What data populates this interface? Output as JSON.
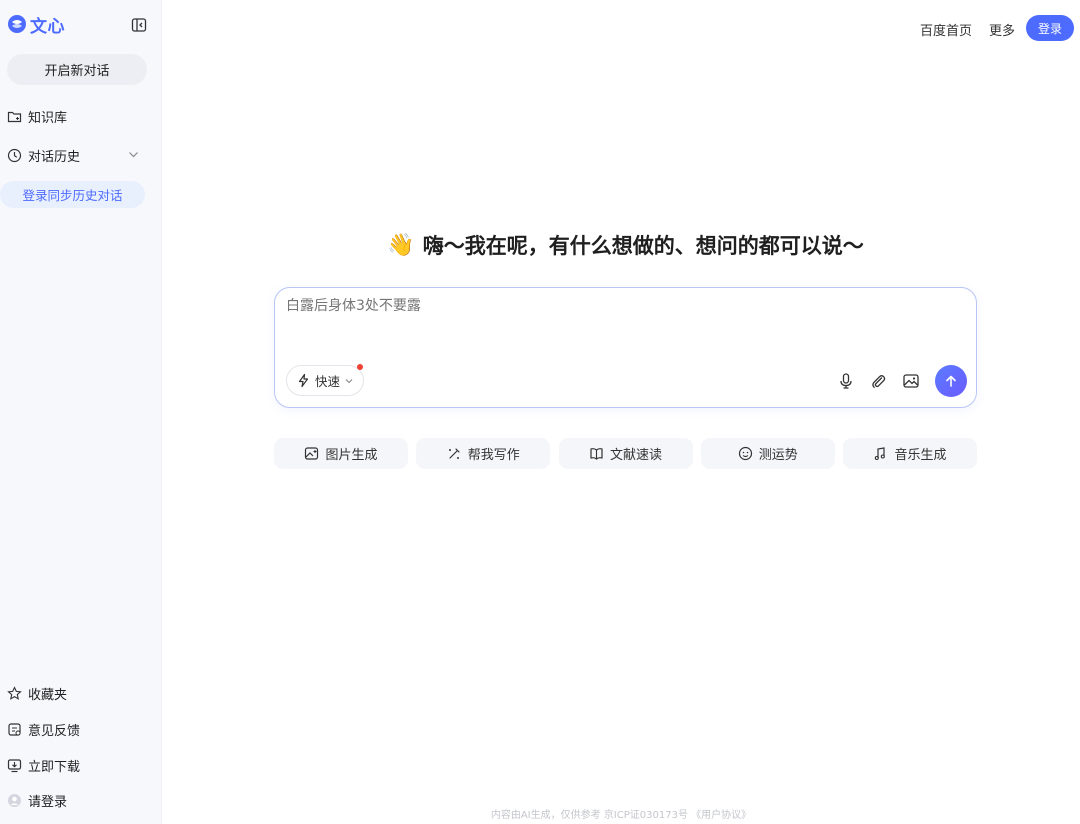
{
  "brand": {
    "name": "文心",
    "accent": "#4d6bfe"
  },
  "sidebar": {
    "new_chat": "开启新对话",
    "items": [
      {
        "label": "知识库",
        "icon": "folder-icon"
      },
      {
        "label": "对话历史",
        "icon": "clock-icon"
      }
    ],
    "login_sync": "登录同步历史对话",
    "bottom": [
      {
        "label": "收藏夹",
        "icon": "star-icon"
      },
      {
        "label": "意见反馈",
        "icon": "feedback-icon"
      },
      {
        "label": "立即下载",
        "icon": "download-icon"
      },
      {
        "label": "请登录",
        "icon": "avatar-icon"
      }
    ]
  },
  "topbar": {
    "links": [
      "百度首页",
      "更多"
    ],
    "login": "登录"
  },
  "main": {
    "greeting_emoji": "👋",
    "greeting": "嗨～我在呢，有什么想做的、想问的都可以说～",
    "input_placeholder": "白露后身体3处不要露",
    "mode_label": "快速",
    "quick_actions": [
      {
        "label": "图片生成",
        "icon": "image-gen-icon"
      },
      {
        "label": "帮我写作",
        "icon": "pen-icon"
      },
      {
        "label": "文献速读",
        "icon": "book-icon"
      },
      {
        "label": "测运势",
        "icon": "fortune-icon"
      },
      {
        "label": "音乐生成",
        "icon": "music-icon"
      }
    ]
  },
  "footer": "内容由AI生成，仅供参考  京ICP证030173号  《用户协议》"
}
